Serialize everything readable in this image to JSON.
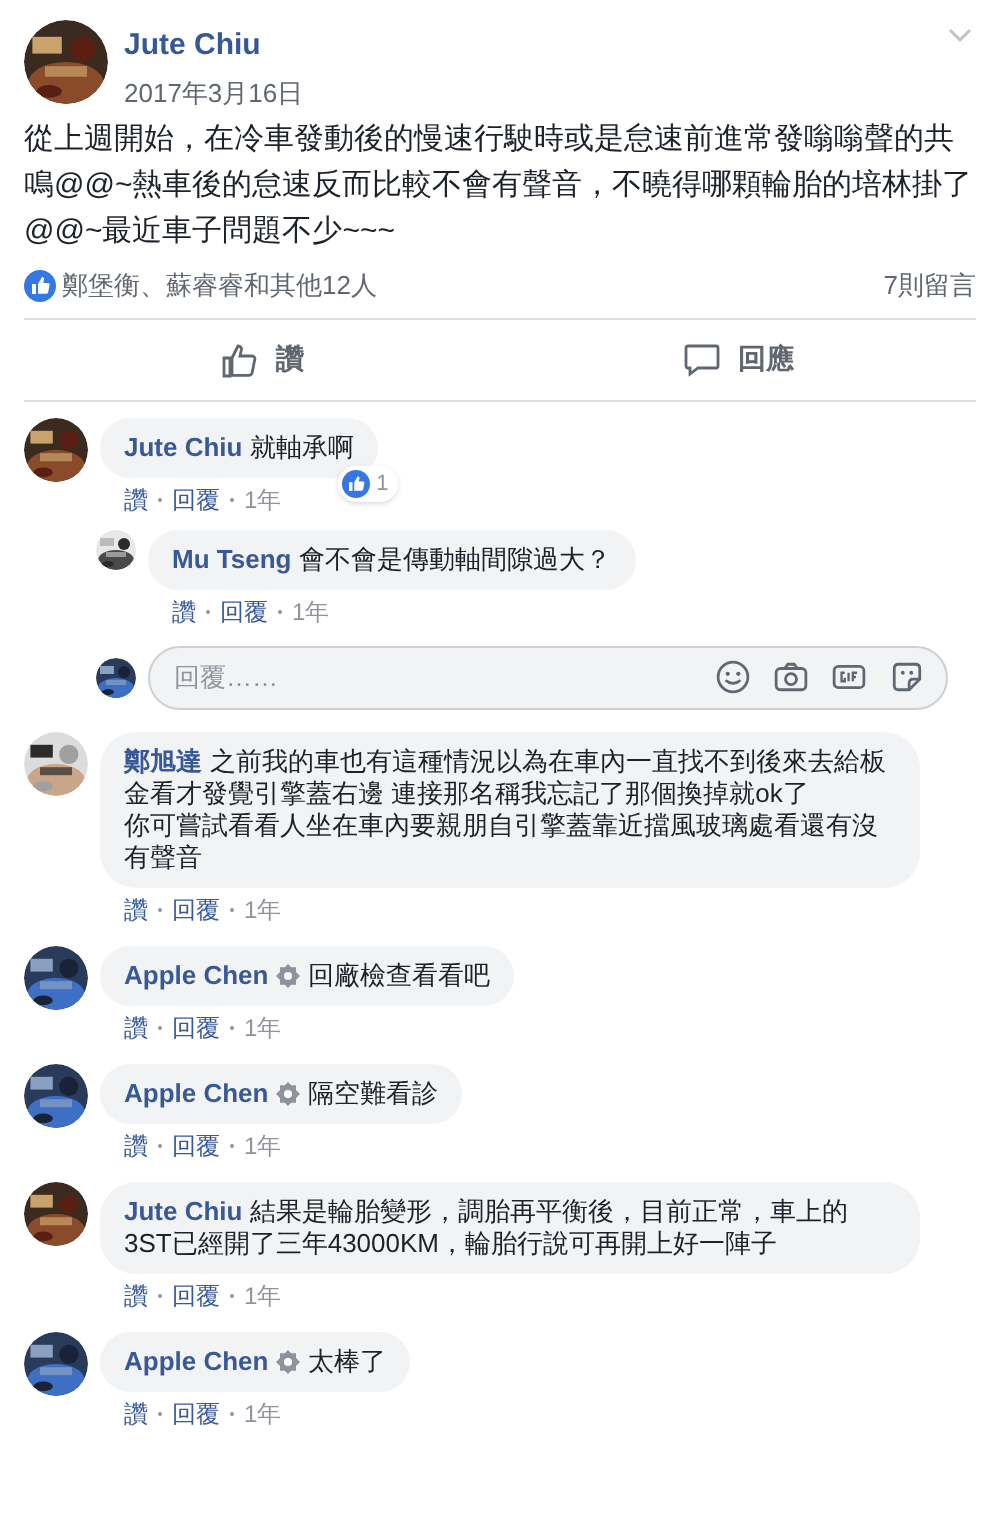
{
  "post": {
    "author": "Jute Chiu",
    "date": "2017年3月16日",
    "text": "從上週開始，在冷車發動後的慢速行駛時或是怠速前進常發嗡嗡聲的共鳴@@~熱車後的怠速反而比較不會有聲音，不曉得哪顆輪胎的培林掛了@@~最近車子問題不少~~~",
    "reactions": "鄭堡衡、蘇睿睿和其他12人",
    "comment_count": "7則留言",
    "actions": [
      {
        "kind": "like",
        "label": "讚"
      },
      {
        "kind": "comment",
        "label": "回應"
      }
    ]
  },
  "comments": [
    {
      "author": "Jute Chiu",
      "verified": false,
      "text": "就軸承啊",
      "reaction_count": "1",
      "actions": [
        "讚",
        "回覆",
        "1年"
      ],
      "replies": [
        {
          "author": "Mu Tseng",
          "verified": false,
          "text": "會不會是傳動軸間隙過大？",
          "actions": [
            "讚",
            "回覆",
            "1年"
          ]
        }
      ],
      "reply_box": {
        "placeholder": "回覆……"
      }
    },
    {
      "author": "鄭旭達",
      "verified": false,
      "text": "之前我的車也有這種情況以為在車內一直找不到後來去給板金看才發覺引擎蓋右邊 連接那名稱我忘記了那個換掉就ok了",
      "text_continued": "你可嘗試看看人坐在車內要親朋自引擎蓋靠近擋風玻璃處看還有沒有聲音",
      "actions": [
        "讚",
        "回覆",
        "1年"
      ]
    },
    {
      "author": "Apple Chen",
      "verified": true,
      "text": "回廠檢查看看吧",
      "actions": [
        "讚",
        "回覆",
        "1年"
      ]
    },
    {
      "author": "Apple Chen",
      "verified": true,
      "text": "隔空難看診",
      "actions": [
        "讚",
        "回覆",
        "1年"
      ]
    },
    {
      "author": "Jute Chiu",
      "verified": false,
      "text": "結果是輪胎變形，調胎再平衡後，目前正常，車上的3ST已經開了三年43000KM，輪胎行說可再開上好一陣子",
      "actions": [
        "讚",
        "回覆",
        "1年"
      ]
    },
    {
      "author": "Apple Chen",
      "verified": true,
      "text": "太棒了",
      "actions": [
        "讚",
        "回覆",
        "1年"
      ]
    }
  ]
}
